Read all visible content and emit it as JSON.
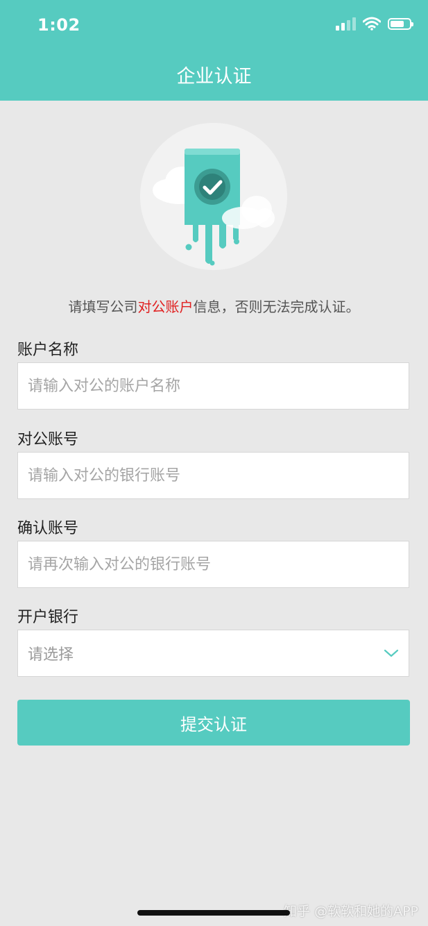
{
  "status_bar": {
    "time": "1:02",
    "signal_bars": 4,
    "signal_active": 2,
    "battery_level": 0.7
  },
  "header": {
    "title": "企业认证"
  },
  "notice": {
    "before": "请填写公司",
    "highlight": "对公账户",
    "after": "信息，否则无法完成认证。"
  },
  "form": {
    "account_name": {
      "label": "账户名称",
      "value": "",
      "placeholder": "请输入对公的账户名称"
    },
    "account_number": {
      "label": "对公账号",
      "value": "",
      "placeholder": "请输入对公的银行账号"
    },
    "confirm_number": {
      "label": "确认账号",
      "value": "",
      "placeholder": "请再次输入对公的银行账号"
    },
    "bank": {
      "label": "开户银行",
      "selected": "请选择"
    }
  },
  "submit": {
    "label": "提交认证"
  },
  "watermark": "知乎 @软软和她的APP",
  "colors": {
    "accent": "#56cbc0",
    "highlight": "#e02020",
    "background": "#e8e8e8"
  },
  "icons": [
    "signal-icon",
    "wifi-icon",
    "battery-icon",
    "verified-card-illustration",
    "chevron-down-icon"
  ]
}
